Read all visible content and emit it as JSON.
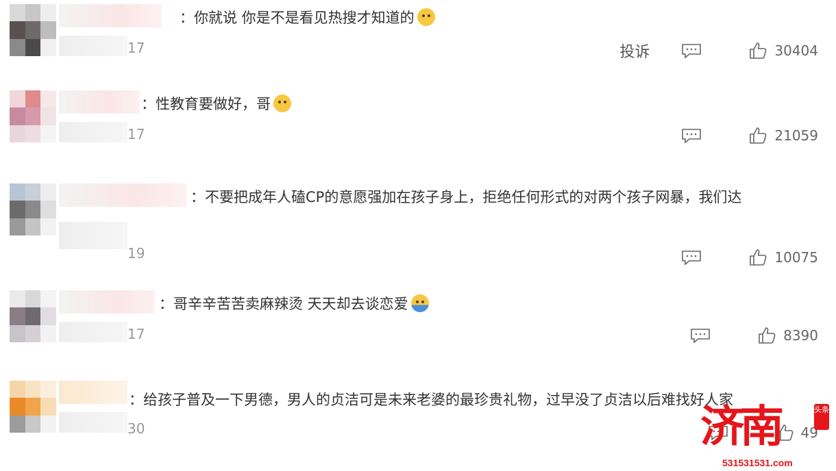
{
  "comments": [
    {
      "text": "：你就说 你是不是看见热搜才知道的",
      "time_fragment": "17",
      "report_label": "投诉",
      "likes": "30404",
      "emoji": "doge-emoji"
    },
    {
      "text": "：性教育要做好，哥",
      "time_fragment": "17",
      "likes": "21059",
      "emoji": "doge-emoji"
    },
    {
      "text": "：不要把成年人磕CP的意愿强加在孩子身上，拒绝任何形式的对两个孩子网暴，我们达",
      "time_fragment": "19",
      "likes": "10075"
    },
    {
      "text": "：哥辛辛苦苦卖麻辣烫 天天却去谈恋爱",
      "time_fragment": "17",
      "likes": "8390",
      "emoji": "hug-emoji"
    },
    {
      "text": "：给孩子普及一下男德，男人的贞洁可是未来老婆的最珍贵礼物，过早没了贞洁以后难找好人家",
      "time_fragment": "30",
      "likes": "49"
    }
  ],
  "watermark": {
    "brand": "济南",
    "seal": "头条",
    "url": "531531531.com"
  }
}
